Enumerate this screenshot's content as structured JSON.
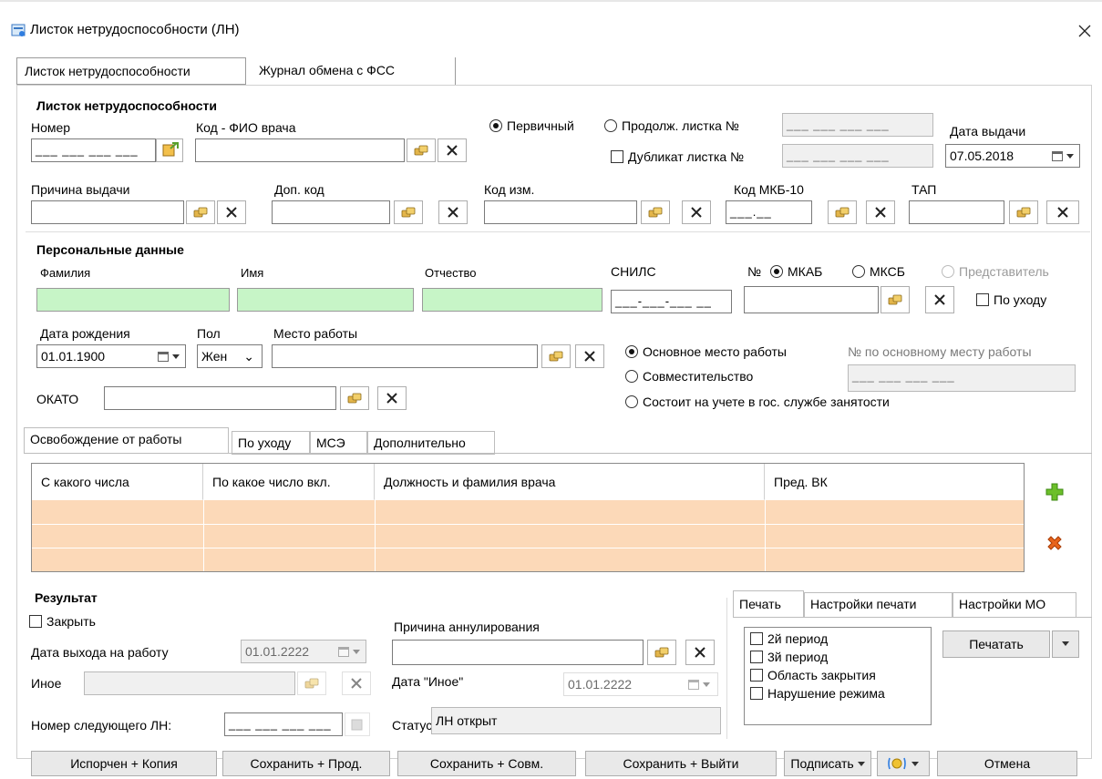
{
  "window": {
    "title": "Листок нетрудоспособности (ЛН)"
  },
  "top_tabs": [
    "Листок нетрудоспособности",
    "Журнал обмена с ФСС"
  ],
  "ln": {
    "group_title": "Листок нетрудоспособности",
    "nomer_label": "Номер",
    "nomer_mask": "___ ___ ___ ___",
    "kod_fio_label": "Код - ФИО врача",
    "kod_fio_value": "",
    "radio_primary": "Первичный",
    "radio_cont": "Продолж. листка №",
    "cont_mask": "___ ___ ___ ___",
    "dup_label": "Дубликат листка №",
    "dup_mask": "___ ___ ___ ___",
    "date_label": "Дата выдачи",
    "date_value": "07.05.2018",
    "prichina_label": "Причина выдачи",
    "dop_kod_label": "Доп. код",
    "kod_izm_label": "Код изм.",
    "mkb_label": "Код МКБ-10",
    "mkb_mask": "___.__",
    "tap_label": "ТАП"
  },
  "personal": {
    "group_title": "Персональные данные",
    "familiya_label": "Фамилия",
    "imya_label": "Имя",
    "otchestvo_label": "Отчество",
    "snils_label": "СНИЛС",
    "snils_mask": "___-___-___ __",
    "no_label": "№",
    "mkab": "МКАБ",
    "mksb": "МКСБ",
    "predstavitel": "Представитель",
    "po_uhodu": "По уходу",
    "dob_label": "Дата рождения",
    "dob_value": "01.01.1900",
    "pol_label": "Пол",
    "pol_value": "Жен",
    "mesto_label": "Место работы",
    "osnovnoe": "Основное место работы",
    "sovmest": "Совместительство",
    "sostoit": "Состоит на учете в гос. службе занятости",
    "no_osn_label": "№ по основному месту работы",
    "no_osn_mask": "___ ___ ___ ___",
    "okato_label": "ОКАТО"
  },
  "sub_tabs": [
    "Освобождение от работы",
    "По уходу",
    "МСЭ",
    "Дополнительно"
  ],
  "grid": {
    "columns": [
      "С какого числа",
      "По какое число вкл.",
      "Должность и фамилия врача",
      "Пред. ВК"
    ]
  },
  "result": {
    "group_title": "Результат",
    "zakryt": "Закрыть",
    "data_vyhoda_label": "Дата выхода на работу",
    "data_vyhoda_value": "01.01.2222",
    "inoe_label": "Иное",
    "next_ln_label": "Номер следующего ЛН:",
    "next_ln_mask": "___ ___ ___ ___",
    "annul_label": "Причина аннулирования",
    "data_inoe_label": "Дата \"Иное\"",
    "data_inoe_value": "01.01.2222",
    "status_label": "Статус",
    "status_value": "ЛН открыт"
  },
  "print": {
    "tabs": [
      "Печать",
      "Настройки печати",
      "Настройки МО"
    ],
    "options": [
      "2й период",
      "3й период",
      "Область закрытия",
      "Нарушение режима"
    ],
    "print_button": "Печатать"
  },
  "footer": {
    "btn_isporchen": "Испорчен + Копия",
    "btn_save_prod": "Сохранить + Прод.",
    "btn_save_sovm": "Сохранить + Совм.",
    "btn_save_exit": "Сохранить + Выйти",
    "btn_sign": "Подписать",
    "btn_cancel": "Отмена"
  },
  "colors": {
    "grid_row": "#fcd9b8",
    "green_field": "#c7f5c7",
    "add": "#6cbf2a",
    "delete": "#e8641b"
  }
}
